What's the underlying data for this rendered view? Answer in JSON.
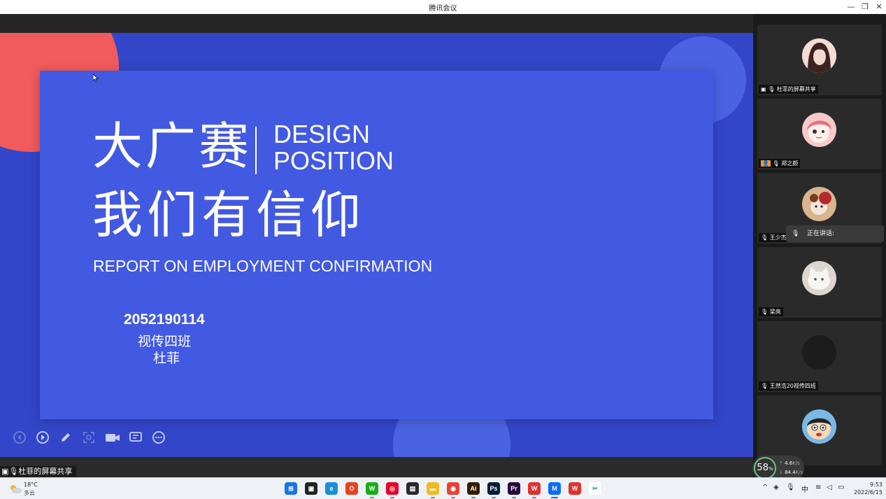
{
  "window": {
    "title": "腾讯会议",
    "minimize_glyph": "—",
    "restore_glyph": "❐",
    "close_glyph": "✕"
  },
  "slide": {
    "title_cn": "大广赛",
    "title_en_1": "DESIGN",
    "title_en_2": "POSITION",
    "headline": "我们有信仰",
    "subtitle": "REPORT ON EMPLOYMENT CONFIRMATION",
    "student_id": "2052190114",
    "class_name": "视传四班",
    "name": "杜菲"
  },
  "share_label": "杜菲的屏幕共享",
  "controls": [
    "prev-icon",
    "play-icon",
    "pen-icon",
    "screenshot-icon",
    "camera-icon",
    "chat-icon",
    "more-icon"
  ],
  "participants": [
    {
      "label": "杜菲的屏幕共享",
      "avatar": "girl-portrait",
      "status_icon": "screen-share-icon",
      "color": "#e8c2b8"
    },
    {
      "label": "郑之颜",
      "avatar": "pink-character",
      "status_icon": "user-icon",
      "color": "#f5a3a8"
    },
    {
      "label": "王少杰",
      "avatar": "red-flower-girl",
      "status_icon": "mic-icon",
      "color": "#d8b28c"
    },
    {
      "label": "梁亮",
      "avatar": "white-cat",
      "status_icon": "mic-icon",
      "color": "#e6e2dc"
    },
    {
      "label": "王然浩20视传四班",
      "avatar": "none",
      "status_icon": "mic-icon",
      "color": "#1a1a1a"
    },
    {
      "label": "",
      "avatar": "cartoon-boy",
      "status_icon": "mic-icon",
      "color": "#7ab9e6"
    }
  ],
  "speaking": {
    "label": "正在讲话:"
  },
  "network": {
    "percent": "58",
    "percent_unit": "%",
    "up": "4.6",
    "down": "84.4",
    "unit": "K/s"
  },
  "weather": {
    "temp": "18°C",
    "desc": "多云"
  },
  "taskbar_apps": [
    {
      "name": "start-icon",
      "color": "#1a73e8",
      "glyph": "⊞"
    },
    {
      "name": "task-view-icon",
      "color": "#222222",
      "glyph": "▣"
    },
    {
      "name": "edge-icon",
      "color": "#1a8fd6",
      "glyph": "e"
    },
    {
      "name": "office-icon",
      "color": "#e8411e",
      "glyph": "O"
    },
    {
      "name": "wechat-icon",
      "color": "#1aad19",
      "glyph": "W"
    },
    {
      "name": "netease-music-icon",
      "color": "#e60026",
      "glyph": "◎"
    },
    {
      "name": "sticky-notes-icon",
      "color": "#2a2a2a",
      "glyph": "▤"
    },
    {
      "name": "file-explorer-icon",
      "color": "#f2b922",
      "glyph": "▬"
    },
    {
      "name": "chrome-icon",
      "color": "#e94235",
      "glyph": "◉"
    },
    {
      "name": "illustrator-icon",
      "color": "#331c00",
      "glyph": "Ai"
    },
    {
      "name": "photoshop-icon",
      "color": "#001e36",
      "glyph": "Ps"
    },
    {
      "name": "premiere-icon",
      "color": "#2a0b3f",
      "glyph": "Pr"
    },
    {
      "name": "wps-icon",
      "color": "#e0322b",
      "glyph": "W"
    },
    {
      "name": "tencent-meeting-icon",
      "color": "#0a6cff",
      "glyph": "M"
    },
    {
      "name": "wps-office-icon",
      "color": "#e0322b",
      "glyph": "W"
    },
    {
      "name": "snipping-tool-icon",
      "color": "#ffffff",
      "glyph": "✂"
    }
  ],
  "tray": {
    "ime": "中",
    "time": "9:53",
    "date": "2022/6/15"
  }
}
